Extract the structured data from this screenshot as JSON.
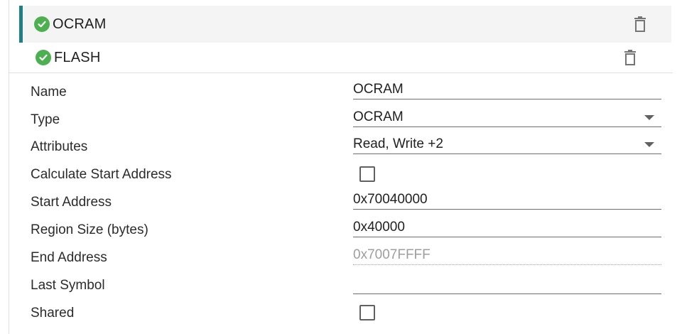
{
  "regions": [
    {
      "title": "OCRAM",
      "status": "valid",
      "action": "delete"
    },
    {
      "title": "FLASH",
      "status": "valid",
      "action": "delete"
    }
  ],
  "form": {
    "name": {
      "label": "Name",
      "value": "OCRAM"
    },
    "type": {
      "label": "Type",
      "value": "OCRAM"
    },
    "attributes": {
      "label": "Attributes",
      "value": "Read, Write +2"
    },
    "calc_start": {
      "label": "Calculate Start Address",
      "checked": false
    },
    "start_address": {
      "label": "Start Address",
      "value": "0x70040000"
    },
    "region_size": {
      "label": "Region Size (bytes)",
      "value": "0x40000"
    },
    "end_address": {
      "label": "End Address",
      "value": "0x7007FFFF"
    },
    "last_symbol": {
      "label": "Last Symbol",
      "value": ""
    },
    "shared": {
      "label": "Shared",
      "checked": false
    }
  },
  "colors": {
    "accent": "#1f7f87",
    "check_green": "#4caf50",
    "header_bg": "#f4f4f4"
  },
  "icons": {
    "status": "check-circle-icon",
    "delete": "trash-icon",
    "dropdown": "caret-down-icon"
  }
}
